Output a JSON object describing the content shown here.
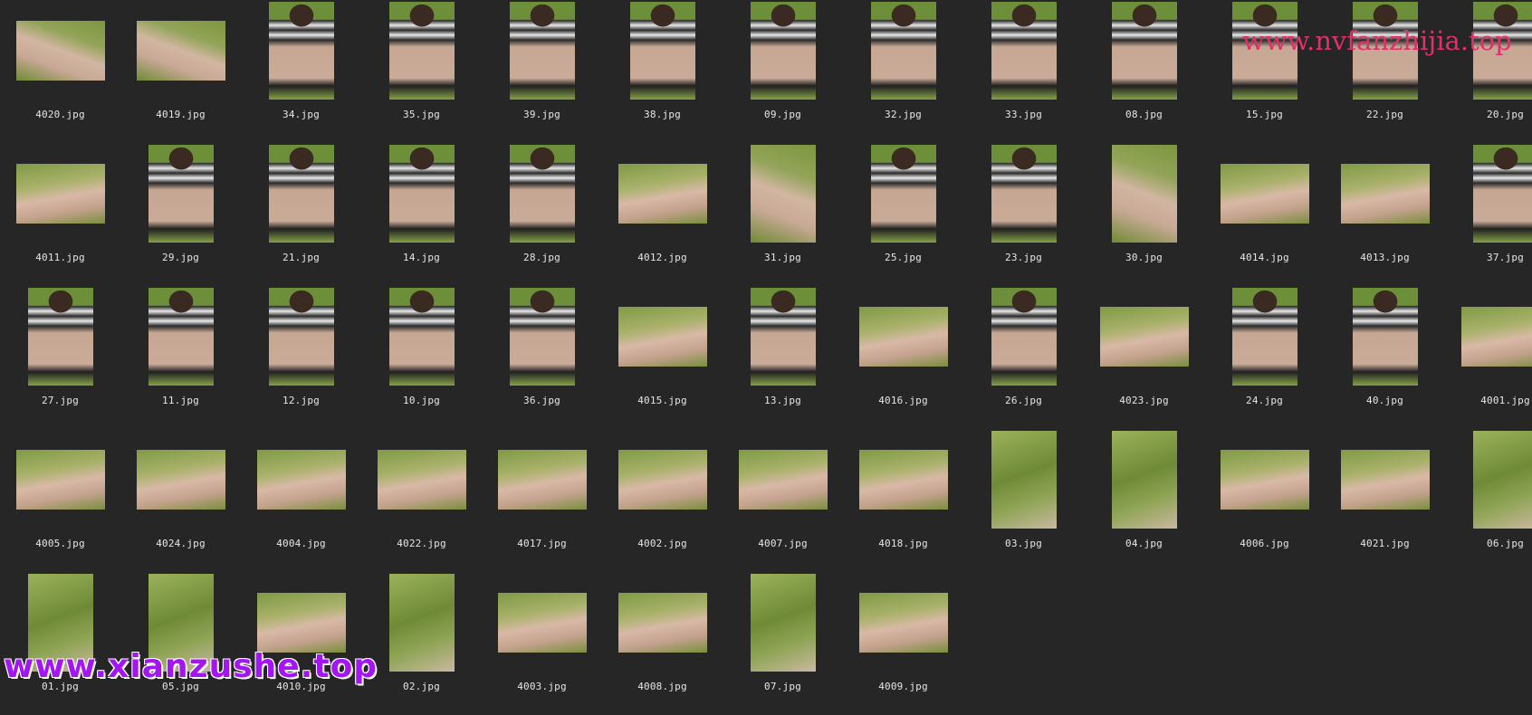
{
  "files": [
    {
      "name": "4020.jpg",
      "orientation": "landscape",
      "scene": "feet"
    },
    {
      "name": "4019.jpg",
      "orientation": "landscape",
      "scene": "feet"
    },
    {
      "name": "34.jpg",
      "orientation": "portrait",
      "scene": "sit"
    },
    {
      "name": "35.jpg",
      "orientation": "portrait",
      "scene": "sit"
    },
    {
      "name": "39.jpg",
      "orientation": "portrait",
      "scene": "sit"
    },
    {
      "name": "38.jpg",
      "orientation": "portrait",
      "scene": "sit"
    },
    {
      "name": "09.jpg",
      "orientation": "portrait",
      "scene": "sit"
    },
    {
      "name": "32.jpg",
      "orientation": "portrait",
      "scene": "sit"
    },
    {
      "name": "33.jpg",
      "orientation": "portrait",
      "scene": "sit"
    },
    {
      "name": "08.jpg",
      "orientation": "portrait",
      "scene": "sit"
    },
    {
      "name": "15.jpg",
      "orientation": "portrait",
      "scene": "sit"
    },
    {
      "name": "22.jpg",
      "orientation": "portrait",
      "scene": "sit"
    },
    {
      "name": "20.jpg",
      "orientation": "portrait",
      "scene": "sit"
    },
    {
      "name": "4011.jpg",
      "orientation": "landscape",
      "scene": "legs"
    },
    {
      "name": "29.jpg",
      "orientation": "portrait",
      "scene": "sit"
    },
    {
      "name": "21.jpg",
      "orientation": "portrait",
      "scene": "sit"
    },
    {
      "name": "14.jpg",
      "orientation": "portrait",
      "scene": "sit"
    },
    {
      "name": "28.jpg",
      "orientation": "portrait",
      "scene": "sit"
    },
    {
      "name": "4012.jpg",
      "orientation": "landscape",
      "scene": "legs"
    },
    {
      "name": "31.jpg",
      "orientation": "portrait",
      "scene": "feet"
    },
    {
      "name": "25.jpg",
      "orientation": "portrait",
      "scene": "sit"
    },
    {
      "name": "23.jpg",
      "orientation": "portrait",
      "scene": "sit"
    },
    {
      "name": "30.jpg",
      "orientation": "portrait",
      "scene": "feet"
    },
    {
      "name": "4014.jpg",
      "orientation": "landscape",
      "scene": "legs"
    },
    {
      "name": "4013.jpg",
      "orientation": "landscape",
      "scene": "legs"
    },
    {
      "name": "37.jpg",
      "orientation": "portrait",
      "scene": "sit"
    },
    {
      "name": "27.jpg",
      "orientation": "portrait",
      "scene": "sit"
    },
    {
      "name": "11.jpg",
      "orientation": "portrait",
      "scene": "sit"
    },
    {
      "name": "12.jpg",
      "orientation": "portrait",
      "scene": "sit"
    },
    {
      "name": "10.jpg",
      "orientation": "portrait",
      "scene": "sit"
    },
    {
      "name": "36.jpg",
      "orientation": "portrait",
      "scene": "sit"
    },
    {
      "name": "4015.jpg",
      "orientation": "landscape",
      "scene": "legs"
    },
    {
      "name": "13.jpg",
      "orientation": "portrait",
      "scene": "sit"
    },
    {
      "name": "4016.jpg",
      "orientation": "landscape",
      "scene": "legs"
    },
    {
      "name": "26.jpg",
      "orientation": "portrait",
      "scene": "sit"
    },
    {
      "name": "4023.jpg",
      "orientation": "landscape",
      "scene": "legs"
    },
    {
      "name": "24.jpg",
      "orientation": "portrait",
      "scene": "sit"
    },
    {
      "name": "40.jpg",
      "orientation": "portrait",
      "scene": "sit"
    },
    {
      "name": "4001.jpg",
      "orientation": "landscape",
      "scene": "legs"
    },
    {
      "name": "4005.jpg",
      "orientation": "landscape",
      "scene": "legs"
    },
    {
      "name": "4024.jpg",
      "orientation": "landscape",
      "scene": "legs"
    },
    {
      "name": "4004.jpg",
      "orientation": "landscape",
      "scene": "legs"
    },
    {
      "name": "4022.jpg",
      "orientation": "landscape",
      "scene": "legs"
    },
    {
      "name": "4017.jpg",
      "orientation": "landscape",
      "scene": "legs"
    },
    {
      "name": "4002.jpg",
      "orientation": "landscape",
      "scene": "legs"
    },
    {
      "name": "4007.jpg",
      "orientation": "landscape",
      "scene": "legs"
    },
    {
      "name": "4018.jpg",
      "orientation": "landscape",
      "scene": "legs"
    },
    {
      "name": "03.jpg",
      "orientation": "portrait",
      "scene": "grass"
    },
    {
      "name": "04.jpg",
      "orientation": "portrait",
      "scene": "grass"
    },
    {
      "name": "4006.jpg",
      "orientation": "landscape",
      "scene": "legs"
    },
    {
      "name": "4021.jpg",
      "orientation": "landscape",
      "scene": "legs"
    },
    {
      "name": "06.jpg",
      "orientation": "portrait",
      "scene": "grass"
    },
    {
      "name": "01.jpg",
      "orientation": "portrait",
      "scene": "grass"
    },
    {
      "name": "05.jpg",
      "orientation": "portrait",
      "scene": "grass"
    },
    {
      "name": "4010.jpg",
      "orientation": "landscape",
      "scene": "legs"
    },
    {
      "name": "02.jpg",
      "orientation": "portrait",
      "scene": "grass"
    },
    {
      "name": "4003.jpg",
      "orientation": "landscape",
      "scene": "legs"
    },
    {
      "name": "4008.jpg",
      "orientation": "landscape",
      "scene": "legs"
    },
    {
      "name": "07.jpg",
      "orientation": "portrait",
      "scene": "grass"
    },
    {
      "name": "4009.jpg",
      "orientation": "landscape",
      "scene": "legs"
    }
  ],
  "columns_per_row": 13,
  "watermarks": {
    "top": "www.nvfanzhijia.top",
    "bottom": "www.xianzushe.top"
  },
  "colors": {
    "background": "#262626",
    "label_text": "#e6e6e6",
    "watermark_top": "#e0306a",
    "watermark_bottom": "#a315f2"
  }
}
